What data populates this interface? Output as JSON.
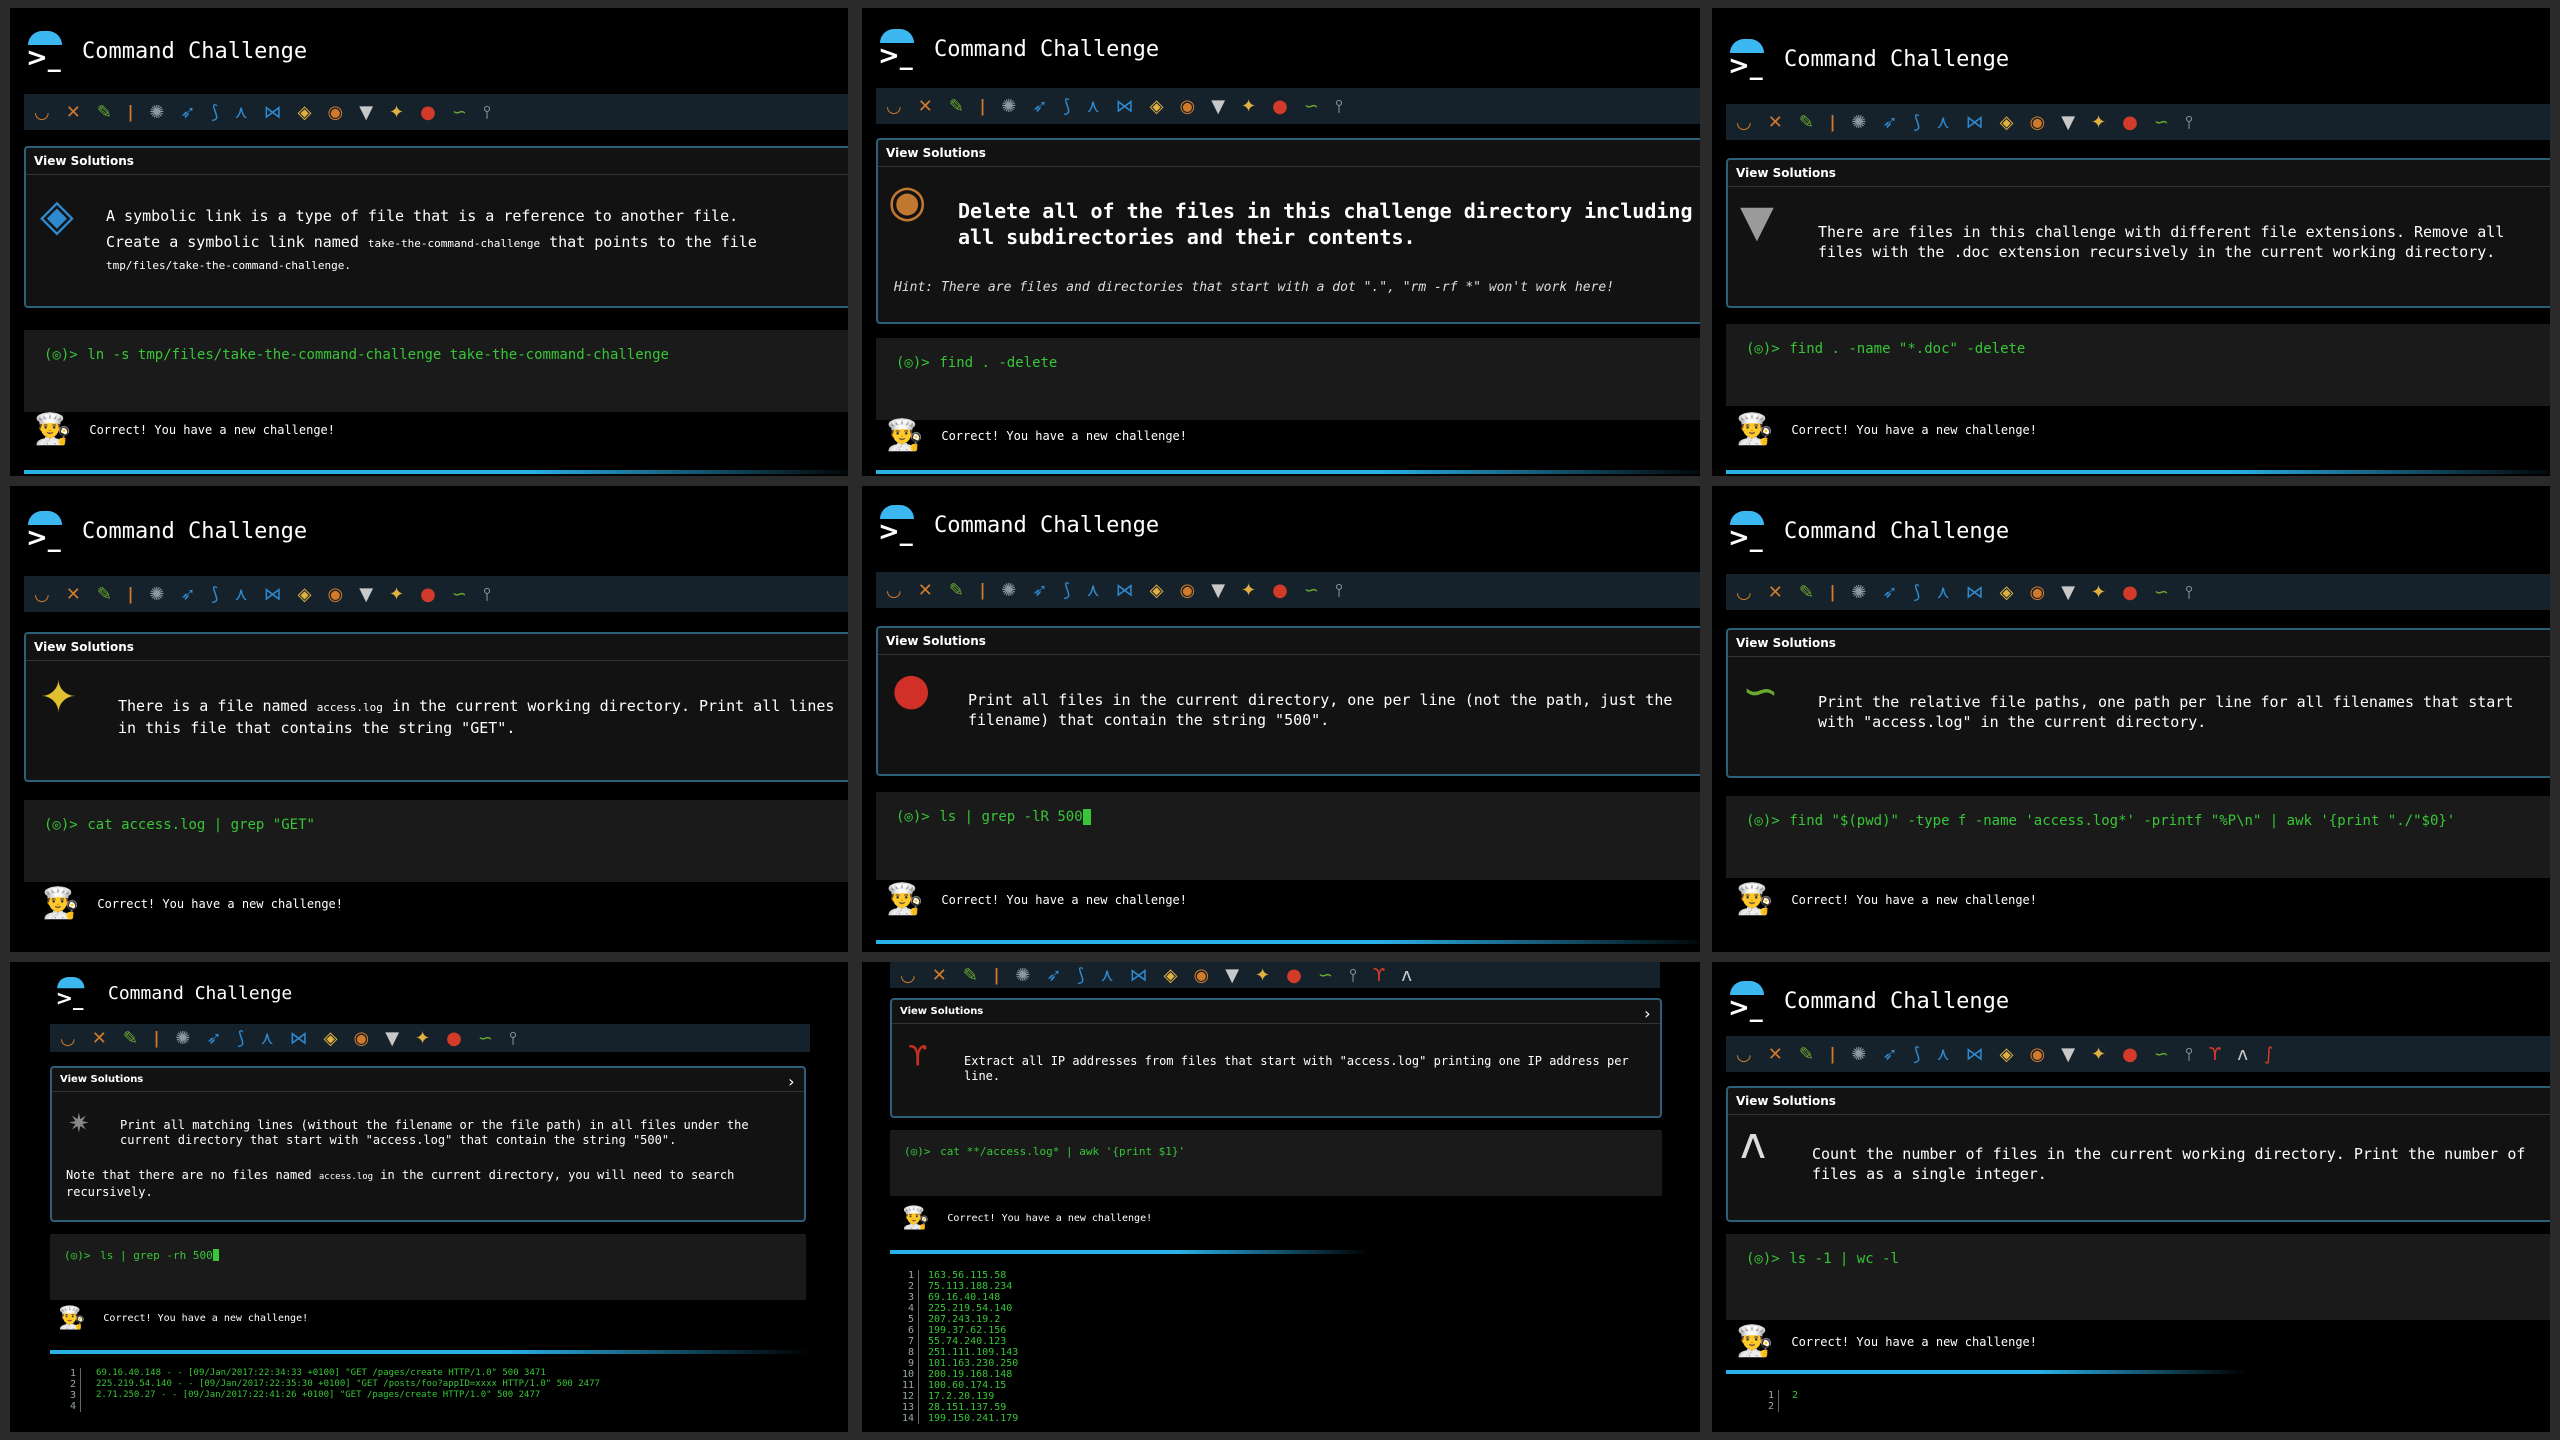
{
  "app_title": "Command Challenge",
  "view_solutions": "View Solutions",
  "result_text": "Correct! You have a new challenge!",
  "prompt": "(◎)>",
  "icons": [
    "snail-icon",
    "butterfly-icon",
    "sprout-icon",
    "bottle-icon",
    "gear-icon",
    "bird-icon",
    "dolphin-icon",
    "shark-icon",
    "fish-icon",
    "tropical-fish-icon",
    "snail-shell-icon",
    "wolf-icon",
    "bee-icon",
    "ladybug-icon",
    "worm-icon",
    "pin-icon"
  ],
  "panels": [
    {
      "challenge": [
        "A symbolic link is a type of file that is a reference to another file.",
        "Create a symbolic link named",
        "take-the-command-challenge",
        "that points to the file",
        "tmp/files/take-the-command-challenge."
      ],
      "command": "ln -s tmp/files/take-the-command-challenge take-the-command-challenge"
    },
    {
      "challenge": [
        "Delete all of the files in this challenge directory including all subdirectories and their contents."
      ],
      "hint": "Hint: There are files and directories that start with a dot \".\", \"rm -rf *\" won't work here!",
      "command": "find . -delete"
    },
    {
      "challenge": [
        "There are files in this challenge with different file extensions. Remove all files with the .doc extension recursively in the current working directory."
      ],
      "command": "find . -name \"*.doc\" -delete"
    },
    {
      "challenge": [
        "There is a file named",
        "access.log",
        "in the current working directory. Print all lines in this file that contains the string \"GET\"."
      ],
      "command": "cat access.log | grep \"GET\""
    },
    {
      "challenge": [
        "Print all files in the current directory, one per line (not the path, just the filename) that contain the string \"500\"."
      ],
      "command": "ls | grep -lR 500"
    },
    {
      "challenge": [
        "Print the relative file paths, one path per line for all filenames that start with \"access.log\" in the current directory."
      ],
      "command": "find \"$(pwd)\" -type f -name 'access.log*' -printf \"%P\\n\" | awk '{print \"./\"$0}'"
    },
    {
      "challenge": [
        "Print all matching lines (without the filename or the file path) in all files under the current directory that start with \"access.log\" that contain the string \"500\".",
        "Note that there are no files named",
        "access.log",
        "in the current directory, you will need to search recursively."
      ],
      "command": "ls | grep -rh 500",
      "output": "69.16.40.148 - - [09/Jan/2017:22:34:33 +0100] \"GET /pages/create HTTP/1.0\" 500 3471\n225.219.54.140 - - [09/Jan/2017:22:35:30 +0100] \"GET /posts/foo?appID=xxxx HTTP/1.0\" 500 2477\n2.71.250.27 - - [09/Jan/2017:22:41:26 +0100] \"GET /pages/create HTTP/1.0\" 500 2477",
      "output_lines": "1\n2\n3\n4"
    },
    {
      "challenge": [
        "Extract all IP addresses from files that start with \"access.log\" printing one IP address per line."
      ],
      "command": "cat **/access.log* | awk '{print $1}'",
      "output": "163.56.115.58\n75.113.188.234\n69.16.40.148\n225.219.54.140\n207.243.19.2\n199.37.62.156\n55.74.240.123\n251.111.109.143\n101.163.230.250\n200.19.168.148\n100.60.174.15\n17.2.20.139\n28.151.137.59\n199.150.241.179",
      "output_lines": "1\n2\n3\n4\n5\n6\n7\n8\n9\n10\n11\n12\n13\n14"
    },
    {
      "challenge": [
        "Count the number of files in the current working directory. Print the number of files as a single integer."
      ],
      "command": "ls -1 | wc -l",
      "output": "2",
      "output_lines": "1\n2"
    }
  ]
}
